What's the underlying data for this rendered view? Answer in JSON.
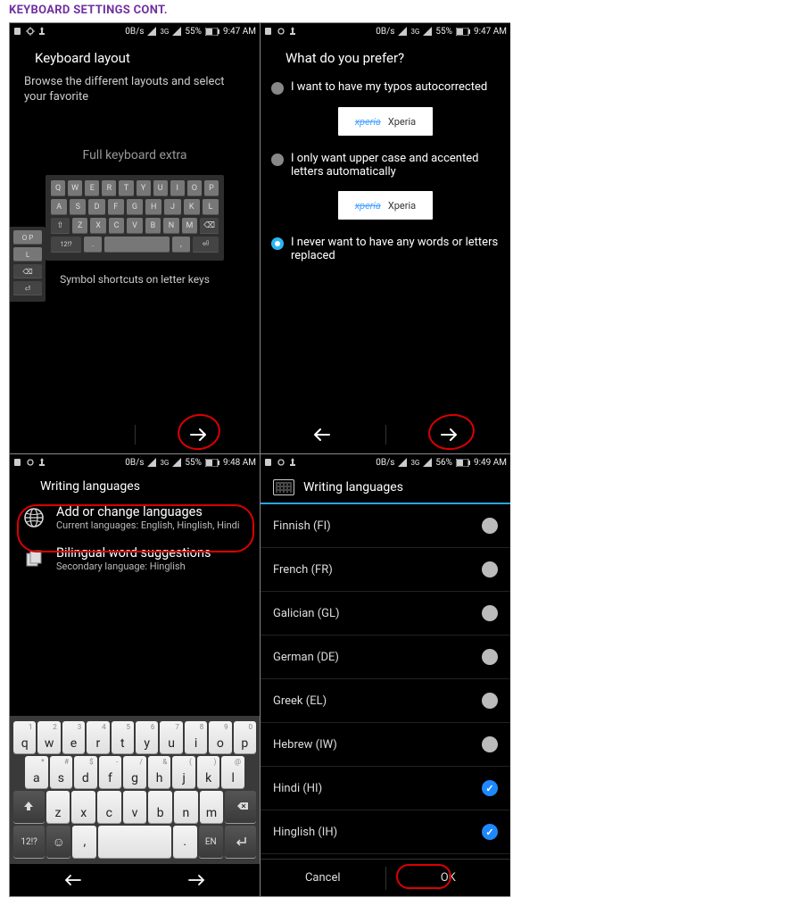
{
  "page_heading": "KEYBOARD SETTINGS CONT.",
  "status_common": {
    "net": "0B/s",
    "sig": "3G",
    "battery": "55%",
    "battery_alt": "56%",
    "time_a": "9:47 AM",
    "time_b": "9:48 AM",
    "time_c": "9:49 AM"
  },
  "shot1": {
    "title": "Keyboard layout",
    "instructions": "Browse the different layouts and select your favorite",
    "caption_mid": "Full keyboard extra",
    "caption_bottom": "Symbol shortcuts on letter keys",
    "keys_row1": [
      "Q",
      "W",
      "E",
      "R",
      "T",
      "Y",
      "U",
      "I",
      "O",
      "P"
    ],
    "keys_row2": [
      "A",
      "S",
      "D",
      "F",
      "G",
      "H",
      "J",
      "K",
      "L"
    ],
    "keys_row3": [
      "Z",
      "X",
      "C",
      "V",
      "B",
      "N",
      "M"
    ],
    "keys_row4": [
      "12!?",
      ".",
      "",
      "",
      "⏎"
    ]
  },
  "shot2": {
    "title": "What do you prefer?",
    "opt1": "I want to have my typos autocorrected",
    "opt2": "I only want upper case and accented letters automatically",
    "opt3": "I never want to have any words or letters replaced",
    "xperia_strike": "xperia",
    "xperia_plain": "Xperia"
  },
  "shot3": {
    "title": "Writing languages",
    "item1_title": "Add or change languages",
    "item1_sub": "Current languages: English, Hinglish, Hindi",
    "item2_title": "Bilingual word suggestions",
    "item2_sub": "Secondary language: Hinglish",
    "kb_row1": [
      {
        "l": "q",
        "t": "1"
      },
      {
        "l": "w",
        "t": "2"
      },
      {
        "l": "e",
        "t": "3"
      },
      {
        "l": "r",
        "t": "4"
      },
      {
        "l": "t",
        "t": "5"
      },
      {
        "l": "y",
        "t": "6"
      },
      {
        "l": "u",
        "t": "7"
      },
      {
        "l": "i",
        "t": "8"
      },
      {
        "l": "o",
        "t": "9"
      },
      {
        "l": "p",
        "t": "0"
      }
    ],
    "kb_row2": [
      {
        "l": "a",
        "t": "*"
      },
      {
        "l": "s",
        "t": "#"
      },
      {
        "l": "d",
        "t": "$"
      },
      {
        "l": "f",
        "t": "-"
      },
      {
        "l": "g",
        "t": "/"
      },
      {
        "l": "h",
        "t": "&"
      },
      {
        "l": "j",
        "t": "("
      },
      {
        "l": "k",
        "t": ")"
      },
      {
        "l": "l",
        "t": "@"
      }
    ],
    "kb_row3_letters": [
      "z",
      "x",
      "c",
      "v",
      "b",
      "n",
      "m"
    ],
    "kb_row4_sym": "12!?",
    "kb_row4_en": "EN"
  },
  "shot4": {
    "title": "Writing languages",
    "languages": [
      {
        "name": "Finnish (FI)",
        "on": false
      },
      {
        "name": "French (FR)",
        "on": false
      },
      {
        "name": "Galician (GL)",
        "on": false
      },
      {
        "name": "German (DE)",
        "on": false
      },
      {
        "name": "Greek (EL)",
        "on": false
      },
      {
        "name": "Hebrew (IW)",
        "on": false
      },
      {
        "name": "Hindi (HI)",
        "on": true
      },
      {
        "name": "Hinglish (IH)",
        "on": true
      }
    ],
    "cancel": "Cancel",
    "ok": "OK"
  }
}
